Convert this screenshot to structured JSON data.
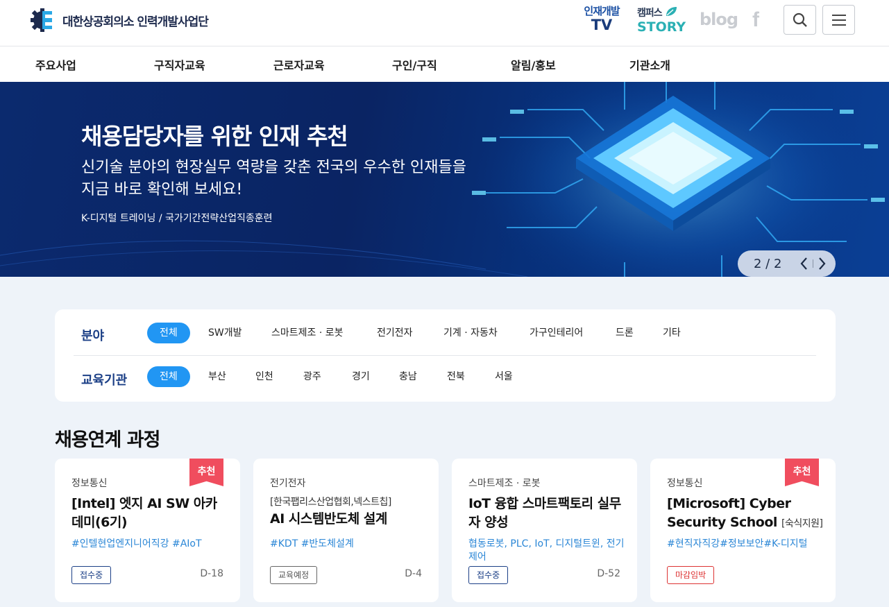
{
  "header": {
    "logo_text": "대한상공회의소 인력개발사업단",
    "tv": {
      "line1": "인재개발",
      "line2": "TV"
    },
    "story": {
      "line1": "캠퍼스",
      "line2": "STORY"
    },
    "blog": "blog",
    "facebook": "f",
    "icons": [
      "search-icon",
      "menu-icon"
    ]
  },
  "nav": {
    "items": [
      "주요사업",
      "구직자교육",
      "근로자교육",
      "구인/구직",
      "알림/홍보",
      "기관소개"
    ]
  },
  "hero": {
    "title": "채용담당자를 위한 인재 추천",
    "subtitle_line1": "신기술 분야의 현장실무 역량을 갖춘 전국의 우수한 인재들을",
    "subtitle_line2": "지금 바로 확인해 보세요!",
    "tag": "K-디지털 트레이닝 / 국가기간전략산업직종훈련",
    "pager": "2 / 2"
  },
  "filter": {
    "field_label": "분야",
    "fields": [
      "전체",
      "SW개발",
      "스마트제조 · 로봇",
      "전기전자",
      "기계 · 자동차",
      "가구인테리어",
      "드론",
      "기타"
    ],
    "org_label": "교육기관",
    "orgs": [
      "전체",
      "부산",
      "인천",
      "광주",
      "경기",
      "충남",
      "전북",
      "서울"
    ],
    "active_color": "#2196f3"
  },
  "section": {
    "title": "채용연계 과정"
  },
  "cards": [
    {
      "category": "정보통신",
      "ribbon": "추천",
      "title": "[Intel] 엣지 AI SW 아카데미(6기)",
      "tags": "#인텔현업엔지니어직강 #AIoT",
      "status": "접수중",
      "dday": "D-18"
    },
    {
      "category": "전기전자",
      "prefix": "[한국팹리스산업협회,넥스트칩]",
      "title": "AI 시스템반도체 설계",
      "tags": "#KDT #반도체설계",
      "status": "교육예정",
      "dday": "D-4"
    },
    {
      "category": "스마트제조 · 로봇",
      "title": "IoT 융합 스마트팩토리 실무자 양성",
      "tags": "협동로봇, PLC, IoT, 디지털트윈, 전기제어",
      "status": "접수중",
      "dday": "D-52"
    },
    {
      "category": "정보통신",
      "ribbon": "추천",
      "title": "[Microsoft] Cyber Security School",
      "note": "[숙식지원]",
      "tags": "#현직자직강#정보보안#K-디지털",
      "status": "마감임박",
      "dday": ""
    }
  ],
  "colors": {
    "brand_navy": "#1b3f86",
    "ribbon": "#f04d5e",
    "tag_blue": "#2a86d6"
  }
}
